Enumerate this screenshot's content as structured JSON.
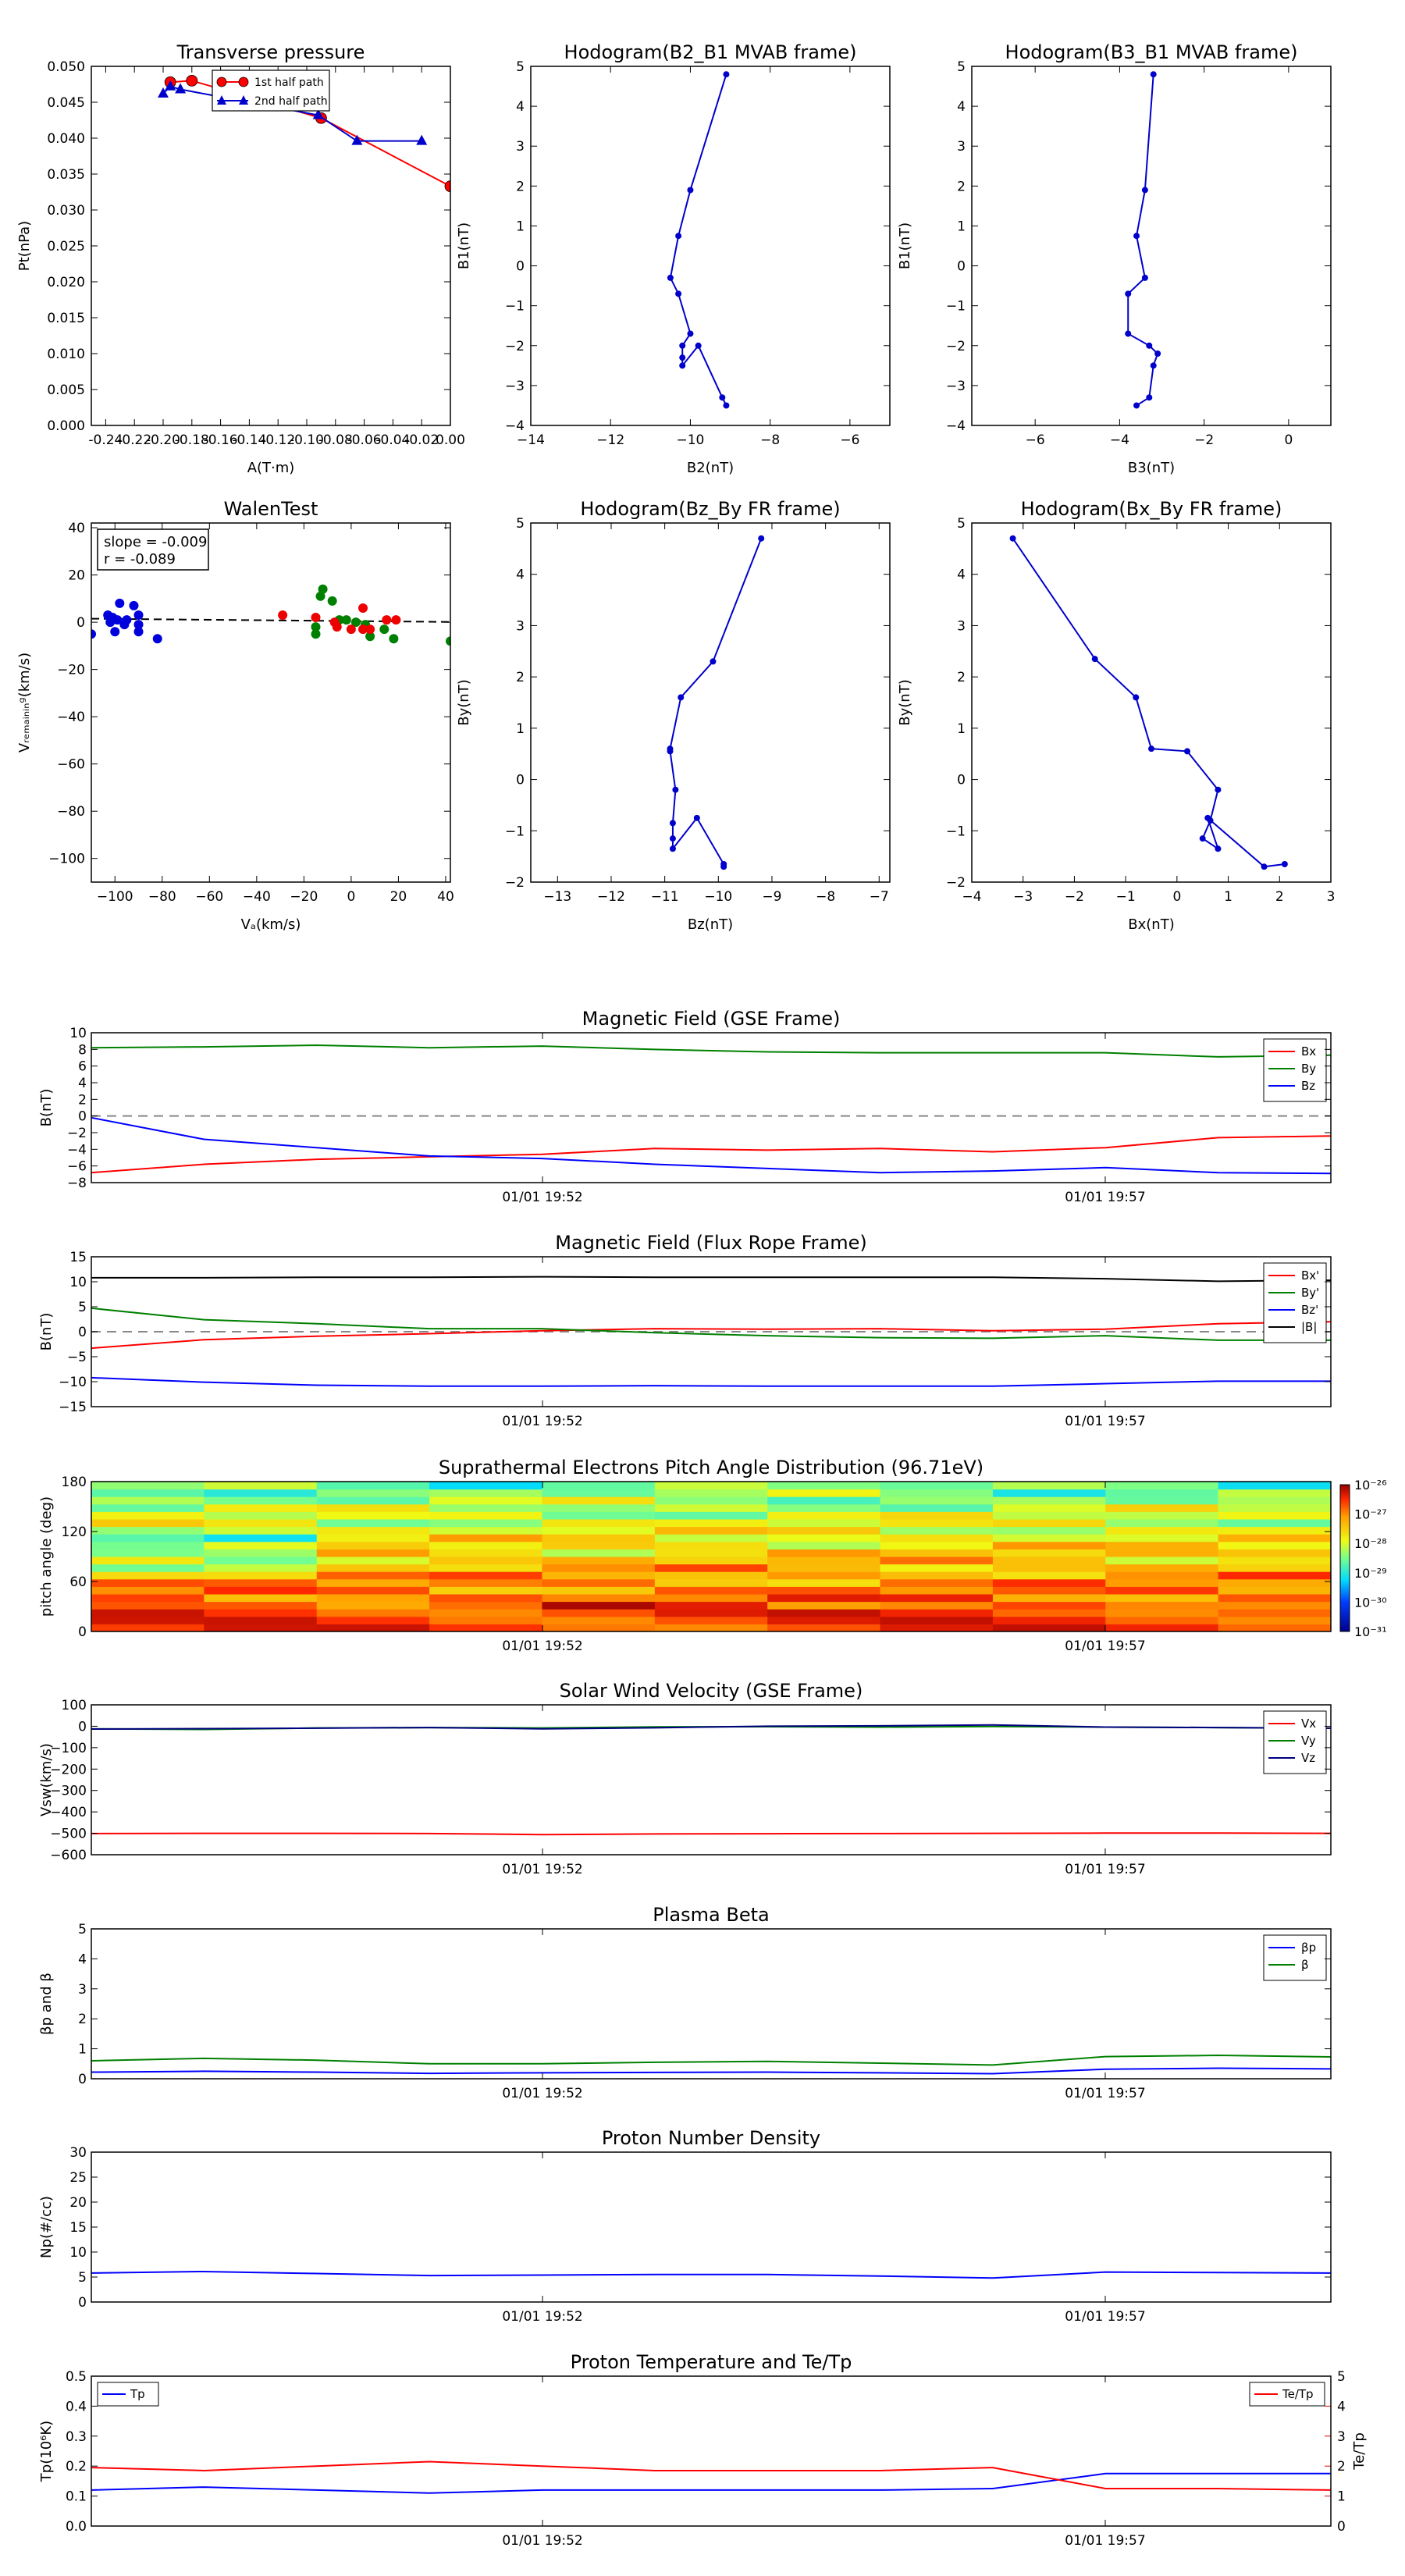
{
  "top_panels": [
    {
      "title": "Transverse pressure",
      "xlabel": "A(T·m)",
      "ylabel": "Pt(nPa)",
      "xlim": [
        -0.25,
        0.0
      ],
      "ylim": [
        0.0,
        0.05
      ],
      "xticks": [
        -0.24,
        -0.22,
        -0.2,
        -0.18,
        -0.16,
        -0.14,
        -0.12,
        -0.1,
        -0.08,
        -0.06,
        -0.04,
        -0.02,
        0.0
      ],
      "xticklabels": [
        "-0.24",
        "-0.22",
        "-0.20",
        "-0.18",
        "-0.16",
        "-0.14",
        "-0.12",
        "-0.10",
        "-0.08",
        "-0.06",
        "-0.04",
        "-0.02",
        "0.00"
      ],
      "yticks": [
        0.0,
        0.005,
        0.01,
        0.015,
        0.02,
        0.025,
        0.03,
        0.035,
        0.04,
        0.045,
        0.05
      ],
      "yticklabels": [
        "0.000",
        "0.005",
        "0.010",
        "0.015",
        "0.020",
        "0.025",
        "0.030",
        "0.035",
        "0.040",
        "0.045",
        "0.050"
      ],
      "series": [
        {
          "name": "1st half path",
          "color": "#ff0000",
          "marker": "circle",
          "x": [
            0.0,
            -0.09,
            -0.18,
            -0.195
          ],
          "y": [
            0.0333,
            0.0428,
            0.048,
            0.0478
          ]
        },
        {
          "name": "2nd half path",
          "color": "#0000cc",
          "marker": "triangle",
          "x": [
            -0.2,
            -0.195,
            -0.188,
            -0.092,
            -0.065,
            -0.02
          ],
          "y": [
            0.0462,
            0.0472,
            0.0468,
            0.0432,
            0.0396,
            0.0396
          ]
        }
      ],
      "legend": "top-center"
    },
    {
      "title": "Hodogram(B2_B1 MVAB frame)",
      "xlabel": "B2(nT)",
      "ylabel": "B1(nT)",
      "xlim": [
        -14,
        -5
      ],
      "ylim": [
        -4,
        5
      ],
      "xticks": [
        -14,
        -12,
        -10,
        -8,
        -6
      ],
      "xticklabels": [
        "−14",
        "−12",
        "−10",
        "−8",
        "−6"
      ],
      "yticks": [
        -4,
        -3,
        -2,
        -1,
        0,
        1,
        2,
        3,
        4,
        5
      ],
      "yticklabels": [
        "−4",
        "−3",
        "−2",
        "−1",
        "0",
        "1",
        "2",
        "3",
        "4",
        "5"
      ],
      "series": [
        {
          "color": "#0000cc",
          "x": [
            -9.1,
            -10.0,
            -10.3,
            -10.5,
            -10.3,
            -10.0,
            -10.2,
            -10.2,
            -10.2,
            -9.8,
            -9.2,
            -9.1
          ],
          "y": [
            4.8,
            1.9,
            0.75,
            -0.3,
            -0.7,
            -1.7,
            -2.0,
            -2.3,
            -2.5,
            -2.0,
            -3.3,
            -3.5
          ]
        }
      ]
    },
    {
      "title": "Hodogram(B3_B1 MVAB frame)",
      "xlabel": "B3(nT)",
      "ylabel": "B1(nT)",
      "xlim": [
        -7.5,
        1
      ],
      "ylim": [
        -4,
        5
      ],
      "xticks": [
        -6,
        -4,
        -2,
        0
      ],
      "xticklabels": [
        "−6",
        "−4",
        "−2",
        "0"
      ],
      "yticks": [
        -4,
        -3,
        -2,
        -1,
        0,
        1,
        2,
        3,
        4,
        5
      ],
      "yticklabels": [
        "−4",
        "−3",
        "−2",
        "−1",
        "0",
        "1",
        "2",
        "3",
        "4",
        "5"
      ],
      "series": [
        {
          "color": "#0000cc",
          "x": [
            -3.2,
            -3.4,
            -3.6,
            -3.4,
            -3.8,
            -3.8,
            -3.3,
            -3.1,
            -3.2,
            -3.3,
            -3.6
          ],
          "y": [
            4.8,
            1.9,
            0.75,
            -0.3,
            -0.7,
            -1.7,
            -2.0,
            -2.2,
            -2.5,
            -3.3,
            -3.5
          ]
        }
      ]
    },
    {
      "title": "WalenTest",
      "xlabel": "Vₐ(km/s)",
      "ylabel": "Vᵣₑₘₐᵢₙᵢₙᵍ(km/s)",
      "xlim": [
        -110,
        42
      ],
      "ylim": [
        -110,
        42
      ],
      "xticks": [
        -100,
        -80,
        -60,
        -40,
        -20,
        0,
        20,
        40
      ],
      "xticklabels": [
        "−100",
        "−80",
        "−60",
        "−40",
        "−20",
        "0",
        "20",
        "40"
      ],
      "yticks": [
        -100,
        -80,
        -60,
        -40,
        -20,
        0,
        20,
        40
      ],
      "yticklabels": [
        "−100",
        "−80",
        "−60",
        "−40",
        "−20",
        "0",
        "20",
        "40"
      ],
      "stats": {
        "slope": "slope = -0.009",
        "r": "r = -0.089"
      },
      "fit": {
        "slope": -0.009,
        "intercept": 0.5
      },
      "groups": [
        {
          "color": "#0000dd",
          "x": [
            -110,
            -103,
            -101,
            -99,
            -98,
            -95,
            -100,
            -96,
            -92,
            -90,
            -90,
            -90,
            -102,
            -82
          ],
          "y": [
            -5,
            3,
            2,
            1,
            8,
            1,
            -4,
            -1,
            7,
            3,
            -1,
            -4,
            0,
            -7
          ]
        },
        {
          "color": "#008000",
          "x": [
            -15,
            -15,
            -13,
            -12,
            -8,
            -5,
            -2,
            2,
            6,
            8,
            14,
            18,
            42
          ],
          "y": [
            -2,
            -5,
            11,
            14,
            9,
            1,
            1,
            0,
            -1,
            -6,
            -3,
            -7,
            -8
          ]
        },
        {
          "color": "#ee0000",
          "x": [
            -29,
            -15,
            -7,
            -6,
            0,
            5,
            5,
            8,
            15,
            19
          ],
          "y": [
            3,
            2,
            0,
            -2,
            -3,
            6,
            -3,
            -3,
            1,
            1
          ]
        }
      ]
    },
    {
      "title": "Hodogram(Bz_By FR frame)",
      "xlabel": "Bz(nT)",
      "ylabel": "By(nT)",
      "xlim": [
        -13.5,
        -6.8
      ],
      "ylim": [
        -2,
        5
      ],
      "xticks": [
        -13,
        -12,
        -11,
        -10,
        -9,
        -8,
        -7
      ],
      "xticklabels": [
        "−13",
        "−12",
        "−11",
        "−10",
        "−9",
        "−8",
        "−7"
      ],
      "yticks": [
        -2,
        -1,
        0,
        1,
        2,
        3,
        4,
        5
      ],
      "yticklabels": [
        "−2",
        "−1",
        "0",
        "1",
        "2",
        "3",
        "4",
        "5"
      ],
      "series": [
        {
          "color": "#0000cc",
          "x": [
            -9.2,
            -10.1,
            -10.7,
            -10.9,
            -10.9,
            -10.8,
            -10.85,
            -10.85,
            -10.85,
            -10.4,
            -9.9,
            -9.9
          ],
          "y": [
            4.7,
            2.3,
            1.6,
            0.6,
            0.55,
            -0.2,
            -0.85,
            -1.15,
            -1.35,
            -0.75,
            -1.65,
            -1.7
          ]
        }
      ]
    },
    {
      "title": "Hodogram(Bx_By FR frame)",
      "xlabel": "Bx(nT)",
      "ylabel": "By(nT)",
      "xlim": [
        -4,
        3
      ],
      "ylim": [
        -2,
        5
      ],
      "xticks": [
        -4,
        -3,
        -2,
        -1,
        0,
        1,
        2,
        3
      ],
      "xticklabels": [
        "−4",
        "−3",
        "−2",
        "−1",
        "0",
        "1",
        "2",
        "3"
      ],
      "yticks": [
        -2,
        -1,
        0,
        1,
        2,
        3,
        4,
        5
      ],
      "yticklabels": [
        "−2",
        "−1",
        "0",
        "1",
        "2",
        "3",
        "4",
        "5"
      ],
      "series": [
        {
          "color": "#0000cc",
          "x": [
            -3.2,
            -1.6,
            -0.8,
            -0.5,
            0.2,
            0.8,
            0.65,
            0.5,
            0.8,
            0.6,
            1.7,
            2.1
          ],
          "y": [
            4.7,
            2.35,
            1.6,
            0.6,
            0.55,
            -0.2,
            -0.8,
            -1.15,
            -1.35,
            -0.75,
            -1.7,
            -1.65
          ]
        }
      ]
    }
  ],
  "time_axis": {
    "ticks": [
      {
        "label": "01/01 19:52",
        "pos": 0.364
      },
      {
        "label": "01/01 19:57",
        "pos": 0.818
      }
    ]
  },
  "time_panels": [
    {
      "kind": "line",
      "title": "Magnetic Field (GSE Frame)",
      "ylabel": "B(nT)",
      "ylim": [
        -8,
        10
      ],
      "yticks": [
        -8,
        -6,
        -4,
        -2,
        0,
        2,
        4,
        6,
        8,
        10
      ],
      "yticklabels": [
        "−8",
        "−6",
        "−4",
        "−2",
        "0",
        "2",
        "4",
        "6",
        "8",
        "10"
      ],
      "zero_line": true,
      "legend": "top-right",
      "series": [
        {
          "name": "Bx",
          "color": "#ff0000",
          "values": [
            -6.8,
            -5.8,
            -5.2,
            -4.9,
            -4.6,
            -3.9,
            -4.1,
            -3.9,
            -4.3,
            -3.8,
            -2.6,
            -2.4
          ]
        },
        {
          "name": "By",
          "color": "#008000",
          "values": [
            8.2,
            8.3,
            8.5,
            8.2,
            8.4,
            8.0,
            7.7,
            7.6,
            7.6,
            7.6,
            7.1,
            7.3
          ]
        },
        {
          "name": "Bz",
          "color": "#0000ff",
          "values": [
            -0.2,
            -2.8,
            -3.8,
            -4.8,
            -5.1,
            -5.8,
            -6.3,
            -6.8,
            -6.6,
            -6.2,
            -6.8,
            -6.9
          ]
        }
      ]
    },
    {
      "kind": "line",
      "title": "Magnetic Field (Flux Rope Frame)",
      "ylabel": "B(nT)",
      "ylim": [
        -15,
        15
      ],
      "yticks": [
        -15,
        -10,
        -5,
        0,
        5,
        10,
        15
      ],
      "yticklabels": [
        "−15",
        "−10",
        "−5",
        "0",
        "5",
        "10",
        "15"
      ],
      "zero_line": true,
      "legend": "top-right",
      "series": [
        {
          "name": "Bx'",
          "color": "#ff0000",
          "values": [
            -3.3,
            -1.6,
            -0.9,
            -0.4,
            0.2,
            0.6,
            0.5,
            0.6,
            0.2,
            0.5,
            1.6,
            2.0
          ]
        },
        {
          "name": "By'",
          "color": "#008000",
          "values": [
            4.7,
            2.4,
            1.6,
            0.6,
            0.6,
            -0.2,
            -0.8,
            -1.2,
            -1.3,
            -0.8,
            -1.7,
            -1.7
          ]
        },
        {
          "name": "Bz'",
          "color": "#0000ff",
          "values": [
            -9.2,
            -10.1,
            -10.7,
            -10.9,
            -10.9,
            -10.8,
            -10.9,
            -10.9,
            -10.9,
            -10.4,
            -9.9,
            -9.9
          ]
        },
        {
          "name": "|B|",
          "color": "#000000",
          "values": [
            10.8,
            10.8,
            10.9,
            10.9,
            11.0,
            10.9,
            10.9,
            10.9,
            10.9,
            10.6,
            10.1,
            10.3
          ]
        }
      ]
    },
    {
      "kind": "heatmap",
      "title": "Suprathermal Electrons Pitch Angle Distribution (96.71eV)",
      "ylabel": "pitch angle (deg)",
      "ylim": [
        0,
        180
      ],
      "yticks": [
        0,
        60,
        120,
        180
      ],
      "yticklabels": [
        "0",
        "60",
        "120",
        "180"
      ],
      "colorbar": {
        "tick_labels": [
          "10⁻²⁶",
          "10⁻²⁷",
          "10⁻²⁸",
          "10⁻²⁹",
          "10⁻³⁰",
          "10⁻³¹"
        ]
      },
      "cols": 11,
      "rows": 20
    },
    {
      "kind": "line",
      "title": "Solar Wind Velocity (GSE Frame)",
      "ylabel": "Vsw(km/s)",
      "ylim": [
        -600,
        100
      ],
      "yticks": [
        -600,
        -500,
        -400,
        -300,
        -200,
        -100,
        0,
        100
      ],
      "yticklabels": [
        "−600",
        "−500",
        "−400",
        "−300",
        "−200",
        "−100",
        "0",
        "100"
      ],
      "legend": "top-right",
      "series": [
        {
          "name": "Vx",
          "color": "#ff0000",
          "values": [
            -501,
            -500,
            -500,
            -501,
            -506,
            -503,
            -502,
            -501,
            -500,
            -499,
            -499,
            -500
          ]
        },
        {
          "name": "Vy",
          "color": "#008000",
          "values": [
            -12,
            -15,
            -8,
            -6,
            -8,
            -3,
            -2,
            -4,
            -1,
            -4,
            -6,
            -9
          ]
        },
        {
          "name": "Vz",
          "color": "#000080",
          "values": [
            -13,
            -11,
            -9,
            -6,
            -12,
            -7,
            0,
            2,
            6,
            -4,
            -6,
            -9
          ]
        }
      ]
    },
    {
      "kind": "line",
      "title": "Plasma Beta",
      "ylabel": "βp and β",
      "ylim": [
        0,
        5
      ],
      "yticks": [
        0,
        1,
        2,
        3,
        4,
        5
      ],
      "yticklabels": [
        "0",
        "1",
        "2",
        "3",
        "4",
        "5"
      ],
      "legend": "top-right",
      "series": [
        {
          "name": "βp",
          "color": "#0000ff",
          "values": [
            0.22,
            0.25,
            0.22,
            0.18,
            0.2,
            0.21,
            0.22,
            0.2,
            0.17,
            0.32,
            0.35,
            0.33
          ]
        },
        {
          "name": "β",
          "color": "#008000",
          "values": [
            0.6,
            0.68,
            0.62,
            0.5,
            0.5,
            0.55,
            0.58,
            0.52,
            0.46,
            0.74,
            0.78,
            0.73
          ]
        }
      ]
    },
    {
      "kind": "line",
      "title": "Proton Number Density",
      "ylabel": "Np(#/cc)",
      "ylim": [
        0,
        30
      ],
      "yticks": [
        0,
        5,
        10,
        15,
        20,
        25,
        30
      ],
      "yticklabels": [
        "0",
        "5",
        "10",
        "15",
        "20",
        "25",
        "30"
      ],
      "series": [
        {
          "color": "#0000ff",
          "values": [
            5.8,
            6.1,
            5.7,
            5.3,
            5.4,
            5.5,
            5.5,
            5.2,
            4.8,
            6.0,
            5.9,
            5.8
          ]
        }
      ]
    },
    {
      "kind": "dual",
      "title": "Proton Temperature and Te/Tp",
      "ylabel": "Tp(10⁶K)",
      "ylabel_right": "Te/Tp",
      "ylim": [
        0,
        0.5
      ],
      "yticks": [
        0,
        0.1,
        0.2,
        0.3,
        0.4,
        0.5
      ],
      "yticklabels": [
        "0.0",
        "0.1",
        "0.2",
        "0.3",
        "0.4",
        "0.5"
      ],
      "ylim_right": [
        0,
        5
      ],
      "yticks_right": [
        0,
        1,
        2,
        3,
        4,
        5
      ],
      "yticklabels_right": [
        "0",
        "1",
        "2",
        "3",
        "4",
        "5"
      ],
      "series": [
        {
          "name": "Tp",
          "color": "#0000ff",
          "axis": "left",
          "values": [
            0.12,
            0.13,
            0.12,
            0.11,
            0.12,
            0.12,
            0.12,
            0.12,
            0.125,
            0.175,
            0.175,
            0.175
          ]
        },
        {
          "name": "Te/Tp",
          "color": "#ff0000",
          "axis": "right",
          "values": [
            1.95,
            1.85,
            2.0,
            2.15,
            2.0,
            1.85,
            1.85,
            1.85,
            1.95,
            1.25,
            1.25,
            1.2
          ]
        }
      ]
    }
  ]
}
